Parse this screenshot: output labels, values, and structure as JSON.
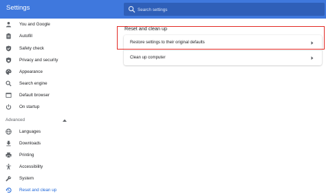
{
  "topbar": {
    "title": "Settings",
    "search": {
      "placeholder": "Search settings",
      "value": ""
    }
  },
  "sidebar": {
    "items": [
      {
        "label": "You and Google",
        "icon": "person-icon"
      },
      {
        "label": "Autofill",
        "icon": "clipboard-icon"
      },
      {
        "label": "Safety check",
        "icon": "shield-check-icon"
      },
      {
        "label": "Privacy and security",
        "icon": "shield-lock-icon"
      },
      {
        "label": "Appearance",
        "icon": "palette-icon"
      },
      {
        "label": "Search engine",
        "icon": "search-icon"
      },
      {
        "label": "Default browser",
        "icon": "browser-window-icon"
      },
      {
        "label": "On startup",
        "icon": "power-icon"
      }
    ],
    "advanced": {
      "label": "Advanced",
      "icon": "caret-up-icon",
      "items": [
        {
          "label": "Languages",
          "icon": "globe-icon"
        },
        {
          "label": "Downloads",
          "icon": "download-icon"
        },
        {
          "label": "Printing",
          "icon": "printer-icon"
        },
        {
          "label": "Accessibility",
          "icon": "accessibility-icon"
        },
        {
          "label": "System",
          "icon": "wrench-icon"
        },
        {
          "label": "Reset and clean up",
          "icon": "restore-icon",
          "active": true
        }
      ]
    }
  },
  "main": {
    "section_title": "Reset and clean up",
    "rows": [
      {
        "label": "Restore settings to their original defaults",
        "icon": "chevron-right-icon"
      },
      {
        "label": "Clean up computer",
        "icon": "chevron-right-icon"
      }
    ]
  },
  "colors": {
    "header": "#3f78dd",
    "search_box": "#2f5fb8",
    "active": "#1a63d8",
    "highlight": "#e2251f"
  }
}
